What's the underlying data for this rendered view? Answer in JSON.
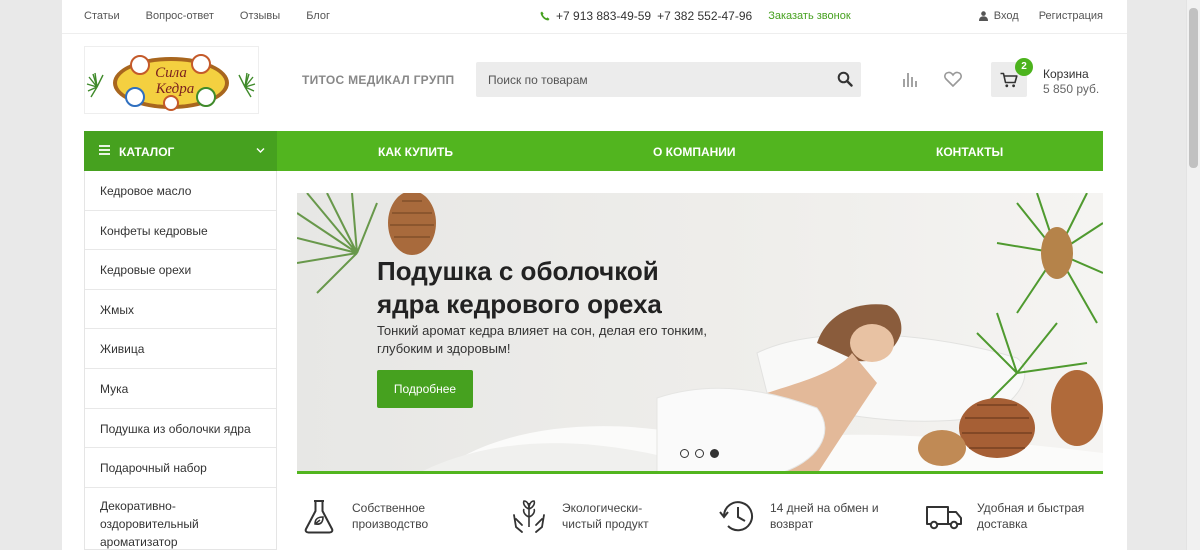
{
  "topbar": {
    "links": [
      "Статьи",
      "Вопрос-ответ",
      "Отзывы",
      "Блог"
    ],
    "phone1": "+7 913 883-49-59",
    "phone2": "+7 382 552-47-96",
    "callback": "Заказать звонок",
    "login": "Вход",
    "register": "Регистрация"
  },
  "header": {
    "logo_text": [
      "Сила",
      "Кедра"
    ],
    "company": "ТИТОС МЕДИКАЛ ГРУПП",
    "search_placeholder": "Поиск по товарам",
    "cart_count": "2",
    "cart_label": "Корзина",
    "cart_sum": "5 850 руб."
  },
  "nav": {
    "catalog": "КАТАЛОГ",
    "links": [
      "КАК КУПИТЬ",
      "О КОМПАНИИ",
      "КОНТАКТЫ"
    ]
  },
  "sidebar": {
    "items": [
      "Кедровое масло",
      "Конфеты кедровые",
      "Кедровые орехи",
      "Жмых",
      "Живица",
      "Мука",
      "Подушка из оболочки ядра",
      "Подарочный набор"
    ],
    "last_item": [
      "Декоративно-",
      "оздоровительный",
      "ароматизатор"
    ]
  },
  "banner": {
    "title": "Подушка с оболочкой ядра кедрового ореха",
    "text": "Тонкий аромат кедра влияет на сон, делая его тонким, глубоким и здоровым!",
    "button": "Подробнее",
    "slide_count": 3,
    "active_slide": 3
  },
  "features": [
    {
      "icon": "flask-icon",
      "line1": "Собственное",
      "line2": "производство"
    },
    {
      "icon": "hands-leaf-icon",
      "line1": "Экологически-",
      "line2": "чистый продукт"
    },
    {
      "icon": "clock-return-icon",
      "line1": "14 дней на обмен и",
      "line2": "возврат"
    },
    {
      "icon": "truck-icon",
      "line1": "Удобная и быстрая",
      "line2": "доставка"
    }
  ],
  "colors": {
    "green": "#52b51f",
    "dark_green": "#46a11f",
    "badge": "#4cb31d"
  }
}
